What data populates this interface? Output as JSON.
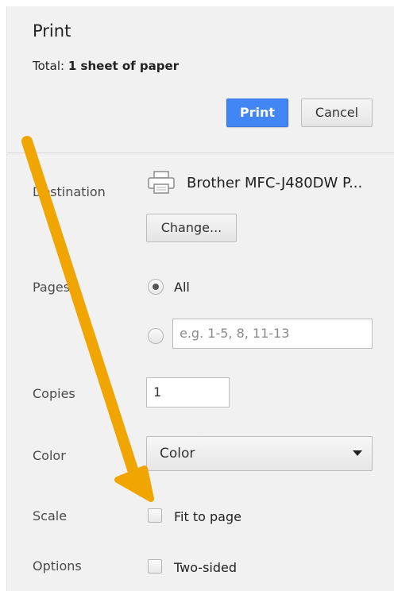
{
  "dialog": {
    "title": "Print",
    "total_label": "Total:",
    "total_value": "1 sheet of paper",
    "print_button": "Print",
    "cancel_button": "Cancel"
  },
  "destination": {
    "label": "Destination",
    "printer_name": "Brother MFC-J480DW P...",
    "change_button": "Change...",
    "icon": "printer-icon"
  },
  "pages": {
    "label": "Pages",
    "option_all": "All",
    "selected": "All",
    "custom_placeholder": "e.g. 1-5, 8, 11-13"
  },
  "copies": {
    "label": "Copies",
    "value": "1"
  },
  "color": {
    "label": "Color",
    "selected": "Color"
  },
  "scale": {
    "label": "Scale",
    "fit_to_page_label": "Fit to page",
    "fit_to_page_checked": false
  },
  "options": {
    "label": "Options",
    "two_sided_label": "Two-sided",
    "two_sided_checked": false
  },
  "annotation": {
    "arrow_color": "#f0a500",
    "points_to": "Fit to page"
  },
  "colors": {
    "accent": "#4285f4",
    "panel_bg": "#f1f1f1"
  }
}
